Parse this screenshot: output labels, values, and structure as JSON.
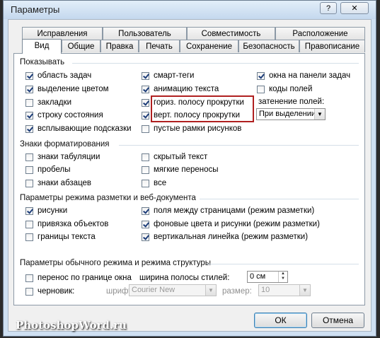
{
  "window": {
    "title": "Параметры",
    "help_label": "?",
    "close_label": "✕"
  },
  "tabs_row1": [
    "Исправления",
    "Пользователь",
    "Совместимость",
    "Расположение"
  ],
  "tabs_row2": [
    "Вид",
    "Общие",
    "Правка",
    "Печать",
    "Сохранение",
    "Безопасность",
    "Правописание"
  ],
  "active_tab": "Вид",
  "show": {
    "title": "Показывать",
    "task_pane": {
      "label": "область задач",
      "checked": true
    },
    "highlight": {
      "label": "выделение цветом",
      "checked": true
    },
    "bookmarks": {
      "label": "закладки",
      "checked": false
    },
    "status_bar": {
      "label": "строку состояния",
      "checked": true
    },
    "tooltips": {
      "label": "всплывающие подсказки",
      "checked": true
    },
    "smart_tags": {
      "label": "смарт-теги",
      "checked": true
    },
    "animated_text": {
      "label": "анимацию текста",
      "checked": true
    },
    "h_scroll": {
      "label": "гориз. полосу прокрутки",
      "checked": true
    },
    "v_scroll": {
      "label": "верт. полосу прокрутки",
      "checked": true
    },
    "picture_placeholders": {
      "label": "пустые рамки рисунков",
      "checked": false
    },
    "taskbar_windows": {
      "label": "окна на панели задач",
      "checked": true
    },
    "field_codes": {
      "label": "коды полей",
      "checked": false
    },
    "field_shading_label": "затенение полей:",
    "field_shading_value": "При выделении"
  },
  "formatting": {
    "title": "Знаки форматирования",
    "tabs": {
      "label": "знаки табуляции",
      "checked": false
    },
    "spaces": {
      "label": "пробелы",
      "checked": false
    },
    "paragraphs": {
      "label": "знаки абзацев",
      "checked": false
    },
    "hidden_text": {
      "label": "скрытый текст",
      "checked": false
    },
    "optional_hyphens": {
      "label": "мягкие переносы",
      "checked": false
    },
    "all": {
      "label": "все",
      "checked": false
    }
  },
  "layout": {
    "title": "Параметры режима разметки и веб-документа",
    "drawings": {
      "label": "рисунки",
      "checked": true
    },
    "object_anchors": {
      "label": "привязка объектов",
      "checked": false
    },
    "text_boundaries": {
      "label": "границы текста",
      "checked": false
    },
    "white_space": {
      "label": "поля между страницами (режим разметки)",
      "checked": true
    },
    "bg_colors": {
      "label": "фоновые цвета и рисунки (режим разметки)",
      "checked": true
    },
    "vertical_ruler": {
      "label": "вертикальная линейка (режим разметки)",
      "checked": true
    }
  },
  "normal": {
    "title": "Параметры обычного режима и режима структуры",
    "wrap": {
      "label": "перенос по границе окна",
      "checked": false
    },
    "draft": {
      "label": "черновик:",
      "checked": false
    },
    "style_area_label": "ширина полосы стилей:",
    "style_area_value": "0 см",
    "font_label": "шрифт:",
    "font_value": "Courier New",
    "size_label": "размер:",
    "size_value": "10"
  },
  "buttons": {
    "ok": "ОК",
    "cancel": "Отмена"
  },
  "watermark": "PhotoshopWord.ru"
}
